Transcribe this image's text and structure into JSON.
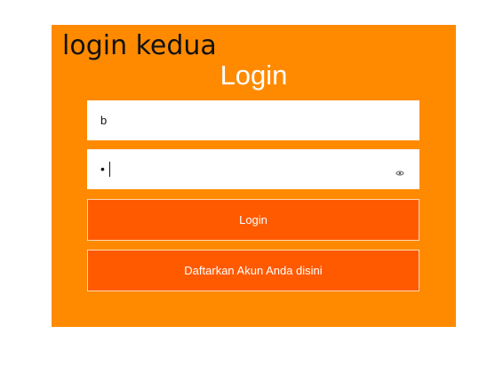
{
  "page": {
    "heading": "login kedua",
    "background_color": "#ff8a00"
  },
  "form": {
    "title": "Login",
    "username_value": "b",
    "password_mask": "•",
    "password_toggle_icon": "eye-icon",
    "login_button_label": "Login",
    "register_button_label": "Daftarkan Akun Anda disini",
    "button_color": "#ff5a00"
  }
}
